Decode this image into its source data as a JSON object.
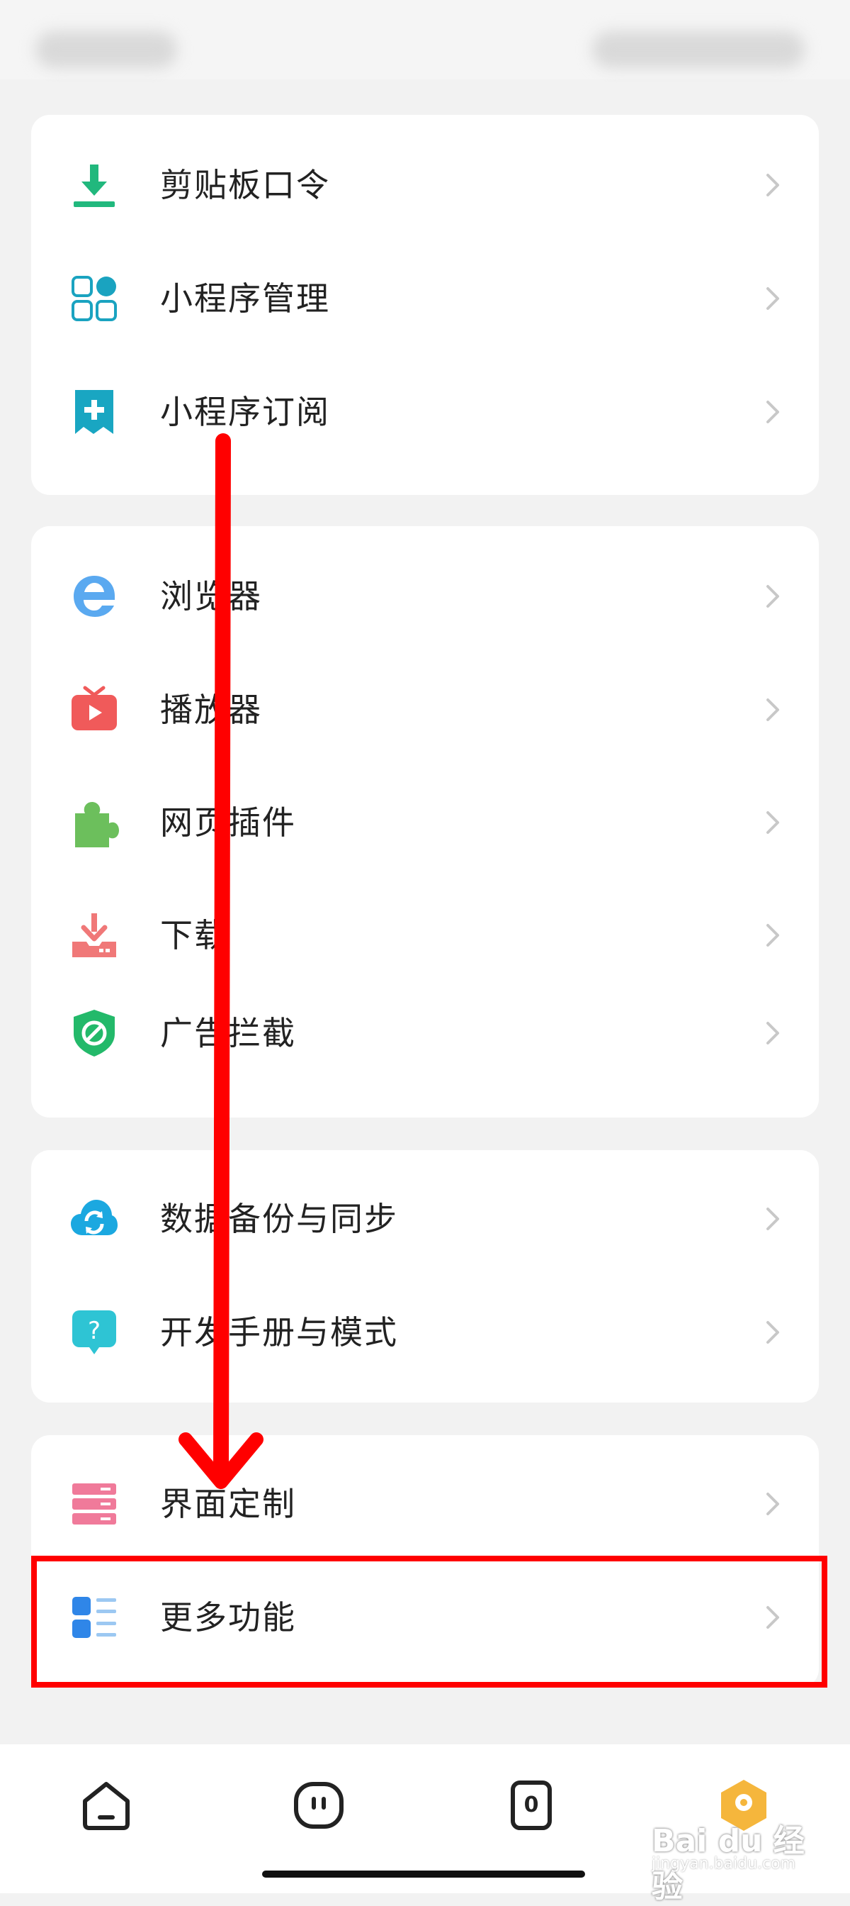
{
  "groups": [
    {
      "items": [
        {
          "id": "clipboard",
          "label": "剪贴板口令",
          "icon": "download-tray-icon"
        },
        {
          "id": "miniapp-manage",
          "label": "小程序管理",
          "icon": "grid-apps-icon"
        },
        {
          "id": "miniapp-subscribe",
          "label": "小程序订阅",
          "icon": "bookmark-plus-icon"
        }
      ]
    },
    {
      "items": [
        {
          "id": "browser",
          "label": "浏览器",
          "icon": "edge-browser-icon"
        },
        {
          "id": "player",
          "label": "播放器",
          "icon": "tv-play-icon"
        },
        {
          "id": "web-plugin",
          "label": "网页插件",
          "icon": "puzzle-icon"
        },
        {
          "id": "download",
          "label": "下载",
          "icon": "download-box-icon"
        },
        {
          "id": "adblock",
          "label": "广告拦截",
          "icon": "shield-block-icon"
        }
      ]
    },
    {
      "items": [
        {
          "id": "backup-sync",
          "label": "数据备份与同步",
          "icon": "cloud-sync-icon"
        },
        {
          "id": "dev-manual",
          "label": "开发手册与模式",
          "icon": "help-bubble-icon"
        }
      ]
    },
    {
      "items": [
        {
          "id": "ui-customize",
          "label": "界面定制",
          "icon": "server-list-icon"
        },
        {
          "id": "more-features",
          "label": "更多功能",
          "icon": "list-blocks-icon"
        }
      ]
    }
  ],
  "tabs": [
    {
      "id": "home",
      "icon": "home-icon"
    },
    {
      "id": "face",
      "icon": "face-icon"
    },
    {
      "id": "windows",
      "icon": "window-count-icon",
      "badge": "0"
    },
    {
      "id": "profile",
      "icon": "avatar-hex-icon"
    }
  ],
  "watermark": {
    "main": "Bai du 经验",
    "sub": "jingyan.baidu.com"
  },
  "colors": {
    "highlight": "#ff0000",
    "arrow": "#ff0000"
  }
}
